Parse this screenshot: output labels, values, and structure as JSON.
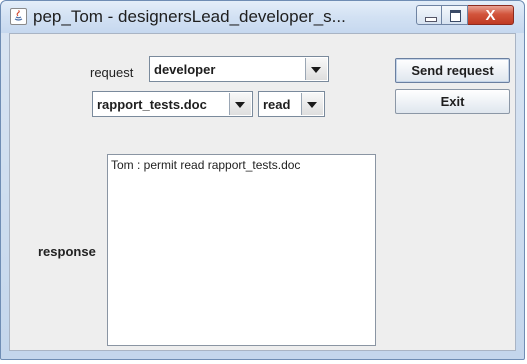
{
  "window": {
    "title": "pep_Tom - designersLead_developer_s...",
    "close_glyph": "X"
  },
  "form": {
    "request_label": "request",
    "request_value": "developer",
    "resource_value": "rapport_tests.doc",
    "action_value": "read",
    "response_label": "response",
    "response_text": "Tom : permit read rapport_tests.doc"
  },
  "buttons": {
    "send_label": "Send request",
    "exit_label": "Exit"
  },
  "icons": {
    "app": "java-cup-icon",
    "dropdown": "chevron-down-icon"
  }
}
